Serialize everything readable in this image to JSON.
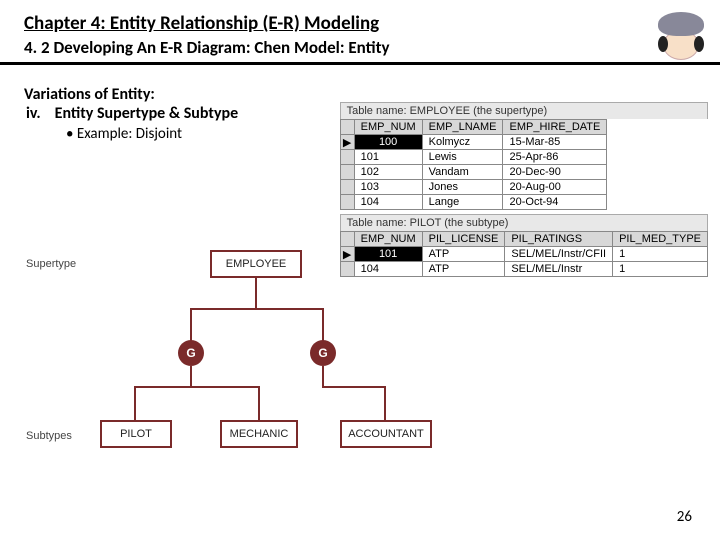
{
  "header": {
    "chapter": "Chapter 4: Entity Relationship (E-R) Modeling",
    "section": "4. 2 Developing An E-R Diagram: Chen Model: Entity"
  },
  "content": {
    "variations_label": "Variations of Entity:",
    "point_num": "iv.",
    "point_text": "Entity Supertype & Subtype",
    "bullet_text": "Example: Disjoint"
  },
  "tables": {
    "employee": {
      "caption": "Table name: EMPLOYEE (the supertype)",
      "headers": [
        "EMP_NUM",
        "EMP_LNAME",
        "EMP_HIRE_DATE"
      ],
      "rows": [
        {
          "marker": "▶",
          "sel": true,
          "c": [
            "100",
            "Kolmycz",
            "15-Mar-85"
          ]
        },
        {
          "marker": "",
          "sel": false,
          "c": [
            "101",
            "Lewis",
            "25-Apr-86"
          ]
        },
        {
          "marker": "",
          "sel": false,
          "c": [
            "102",
            "Vandam",
            "20-Dec-90"
          ]
        },
        {
          "marker": "",
          "sel": false,
          "c": [
            "103",
            "Jones",
            "20-Aug-00"
          ]
        },
        {
          "marker": "",
          "sel": false,
          "c": [
            "104",
            "Lange",
            "20-Oct-94"
          ]
        }
      ]
    },
    "pilot": {
      "caption": "Table name: PILOT (the subtype)",
      "headers": [
        "EMP_NUM",
        "PIL_LICENSE",
        "PIL_RATINGS",
        "PIL_MED_TYPE"
      ],
      "rows": [
        {
          "marker": "▶",
          "sel": true,
          "c": [
            "101",
            "ATP",
            "SEL/MEL/Instr/CFII",
            "1"
          ]
        },
        {
          "marker": "",
          "sel": false,
          "c": [
            "104",
            "ATP",
            "SEL/MEL/Instr",
            "1"
          ]
        }
      ]
    }
  },
  "diagram": {
    "supertype_label": "Supertype",
    "subtype_label": "Subtypes",
    "employee": "EMPLOYEE",
    "pilot": "PILOT",
    "mechanic": "MECHANIC",
    "accountant": "ACCOUNTANT",
    "g": "G"
  },
  "page_number": "26"
}
